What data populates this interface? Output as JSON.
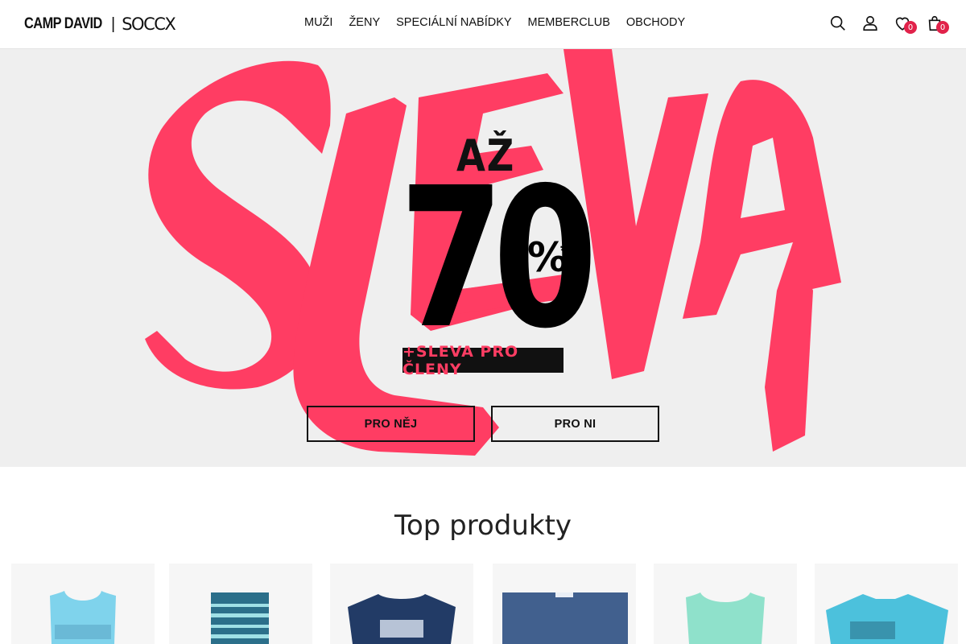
{
  "header": {
    "brand_primary": "CAMP DAVID",
    "brand_secondary": "SOCCX",
    "nav": [
      "MUŽI",
      "ŽENY",
      "SPECIÁLNÍ NABÍDKY",
      "MEMBERCLUB",
      "OBCHODY"
    ],
    "wishlist_count": "0",
    "cart_count": "0"
  },
  "hero": {
    "headline": "SLEVA",
    "prefix": "AŽ",
    "number": "70",
    "percent": "%",
    "asterisk": "*",
    "member_text": "+SLEVA PRO ČLENY",
    "button_him": "PRO NĚJ",
    "button_her": "PRO NI",
    "brush_color": "#ff3d63"
  },
  "products": {
    "title": "Top produkty",
    "items": [
      {
        "image": "tank-top-light-blue",
        "color": "#7fd3ec"
      },
      {
        "image": "swim-shorts-striped",
        "color": "#2b6f8a"
      },
      {
        "image": "t-shirt-navy",
        "color": "#223b66"
      },
      {
        "image": "shorts-blue",
        "color": "#41608e"
      },
      {
        "image": "henley-top-mint",
        "color": "#8fe1cb"
      },
      {
        "image": "polo-shirt-turquoise",
        "color": "#4cc1dc"
      }
    ]
  }
}
